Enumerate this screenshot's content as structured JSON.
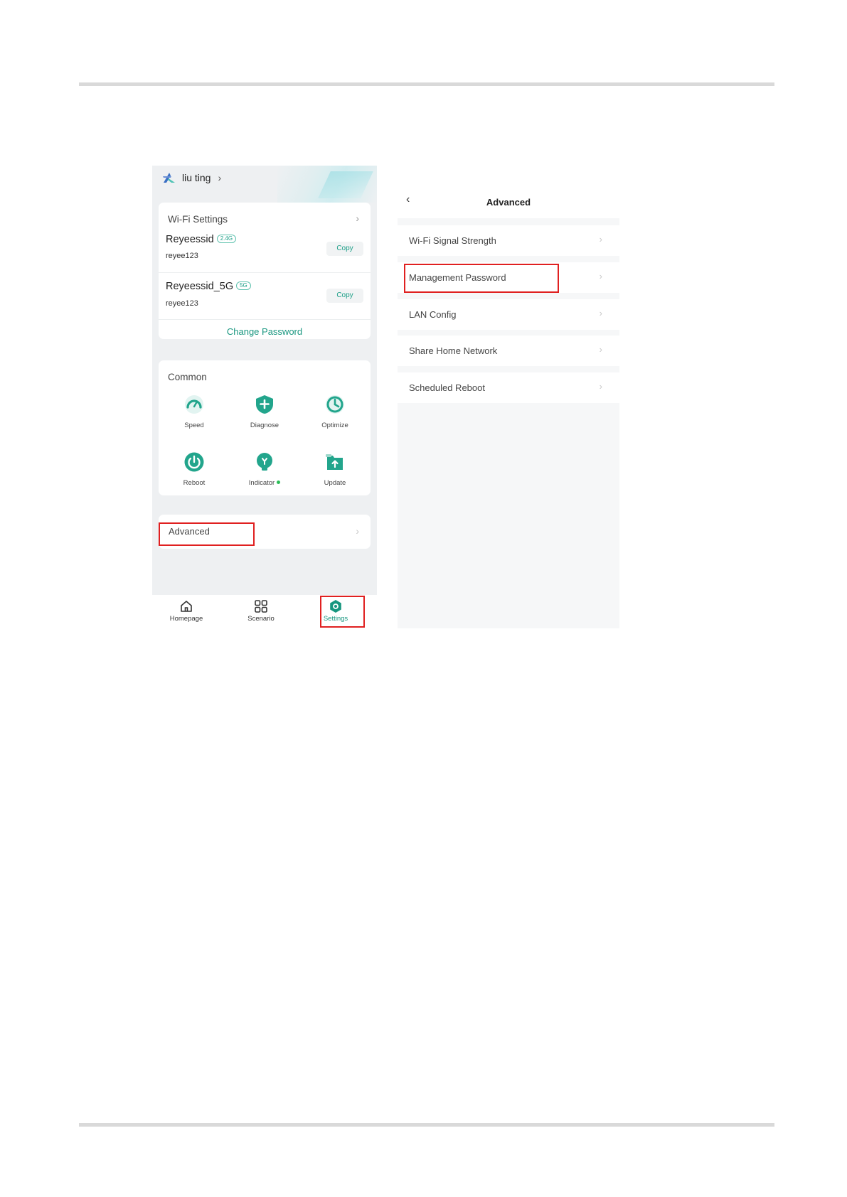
{
  "left_screen": {
    "user": {
      "name": "liu ting"
    },
    "wifi": {
      "title": "Wi-Fi Settings",
      "networks": [
        {
          "ssid": "Reyeessid",
          "band": "2.4G",
          "password": "reyee123",
          "copy_label": "Copy"
        },
        {
          "ssid": "Reyeessid_5G",
          "band": "5G",
          "password": "reyee123",
          "copy_label": "Copy"
        }
      ],
      "change_password": "Change Password"
    },
    "common": {
      "title": "Common",
      "tools": [
        {
          "label": "Speed",
          "icon": "speedometer-icon"
        },
        {
          "label": "Diagnose",
          "icon": "shield-plus-icon"
        },
        {
          "label": "Optimize",
          "icon": "optimize-icon"
        },
        {
          "label": "Reboot",
          "icon": "power-icon"
        },
        {
          "label": "Indicator",
          "icon": "lightbulb-icon"
        },
        {
          "label": "Update",
          "icon": "upload-icon"
        }
      ]
    },
    "advanced": {
      "label": "Advanced"
    },
    "nav": [
      {
        "label": "Homepage",
        "icon": "home-icon"
      },
      {
        "label": "Scenario",
        "icon": "grid-icon"
      },
      {
        "label": "Settings",
        "icon": "gear-icon"
      }
    ]
  },
  "right_screen": {
    "title": "Advanced",
    "items": [
      "Wi-Fi Signal Strength",
      "Management Password",
      "LAN Config",
      "Share Home Network",
      "Scheduled Reboot"
    ]
  },
  "colors": {
    "accent": "#17967f",
    "highlight_box": "#e02020",
    "indicator_dot": "#2bbd57"
  }
}
